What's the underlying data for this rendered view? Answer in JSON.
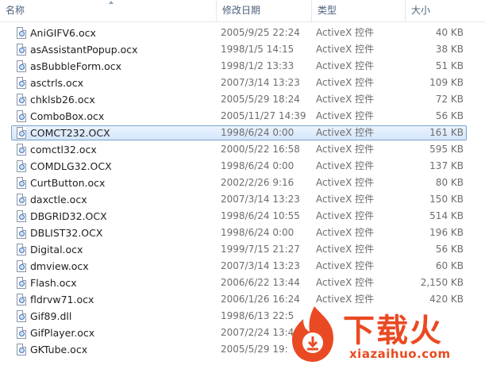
{
  "header": {
    "name": "名称",
    "date": "修改日期",
    "type": "类型",
    "size": "大小"
  },
  "files": [
    {
      "name": "AniGIFV6.ocx",
      "date": "2005/9/25 22:24",
      "type": "ActiveX 控件",
      "size": "40 KB"
    },
    {
      "name": "asAssistantPopup.ocx",
      "date": "1998/1/5 14:15",
      "type": "ActiveX 控件",
      "size": "38 KB"
    },
    {
      "name": "asBubbleForm.ocx",
      "date": "1998/1/2 13:33",
      "type": "ActiveX 控件",
      "size": "51 KB"
    },
    {
      "name": "asctrls.ocx",
      "date": "2007/3/14 13:23",
      "type": "ActiveX 控件",
      "size": "109 KB"
    },
    {
      "name": "chklsb26.ocx",
      "date": "2005/5/29 18:24",
      "type": "ActiveX 控件",
      "size": "72 KB"
    },
    {
      "name": "ComboBox.ocx",
      "date": "2005/11/27 14:39",
      "type": "ActiveX 控件",
      "size": "56 KB"
    },
    {
      "name": "COMCT232.OCX",
      "date": "1998/6/24 0:00",
      "type": "ActiveX 控件",
      "size": "161 KB",
      "selected": true
    },
    {
      "name": "comctl32.ocx",
      "date": "2000/5/22 16:58",
      "type": "ActiveX 控件",
      "size": "595 KB"
    },
    {
      "name": "COMDLG32.OCX",
      "date": "1998/6/24 0:00",
      "type": "ActiveX 控件",
      "size": "137 KB"
    },
    {
      "name": "CurtButton.ocx",
      "date": "2002/2/26 9:16",
      "type": "ActiveX 控件",
      "size": "80 KB"
    },
    {
      "name": "daxctle.ocx",
      "date": "2007/3/14 13:23",
      "type": "ActiveX 控件",
      "size": "150 KB"
    },
    {
      "name": "DBGRID32.OCX",
      "date": "1998/6/24 10:55",
      "type": "ActiveX 控件",
      "size": "514 KB"
    },
    {
      "name": "DBLIST32.OCX",
      "date": "1998/6/24 0:00",
      "type": "ActiveX 控件",
      "size": "196 KB"
    },
    {
      "name": "Digital.ocx",
      "date": "1999/7/15 21:27",
      "type": "ActiveX 控件",
      "size": "56 KB"
    },
    {
      "name": "dmview.ocx",
      "date": "2007/3/14 13:23",
      "type": "ActiveX 控件",
      "size": "60 KB"
    },
    {
      "name": "Flash.ocx",
      "date": "2006/6/22 13:44",
      "type": "ActiveX 控件",
      "size": "2,150 KB"
    },
    {
      "name": "fldrvw71.ocx",
      "date": "2006/1/26 16:24",
      "type": "ActiveX 控件",
      "size": "420 KB"
    },
    {
      "name": "Gif89.dll",
      "date": "1998/6/13 22:5",
      "type": "",
      "size": ""
    },
    {
      "name": "GifPlayer.ocx",
      "date": "2007/2/24 13:4",
      "type": "",
      "size": ""
    },
    {
      "name": "GKTube.ocx",
      "date": "2005/5/29 19:",
      "type": "",
      "size": ""
    }
  ],
  "watermark": {
    "brand": "下载火",
    "url": "xiazaihuo.com",
    "brand_color": "#ea4a23"
  }
}
